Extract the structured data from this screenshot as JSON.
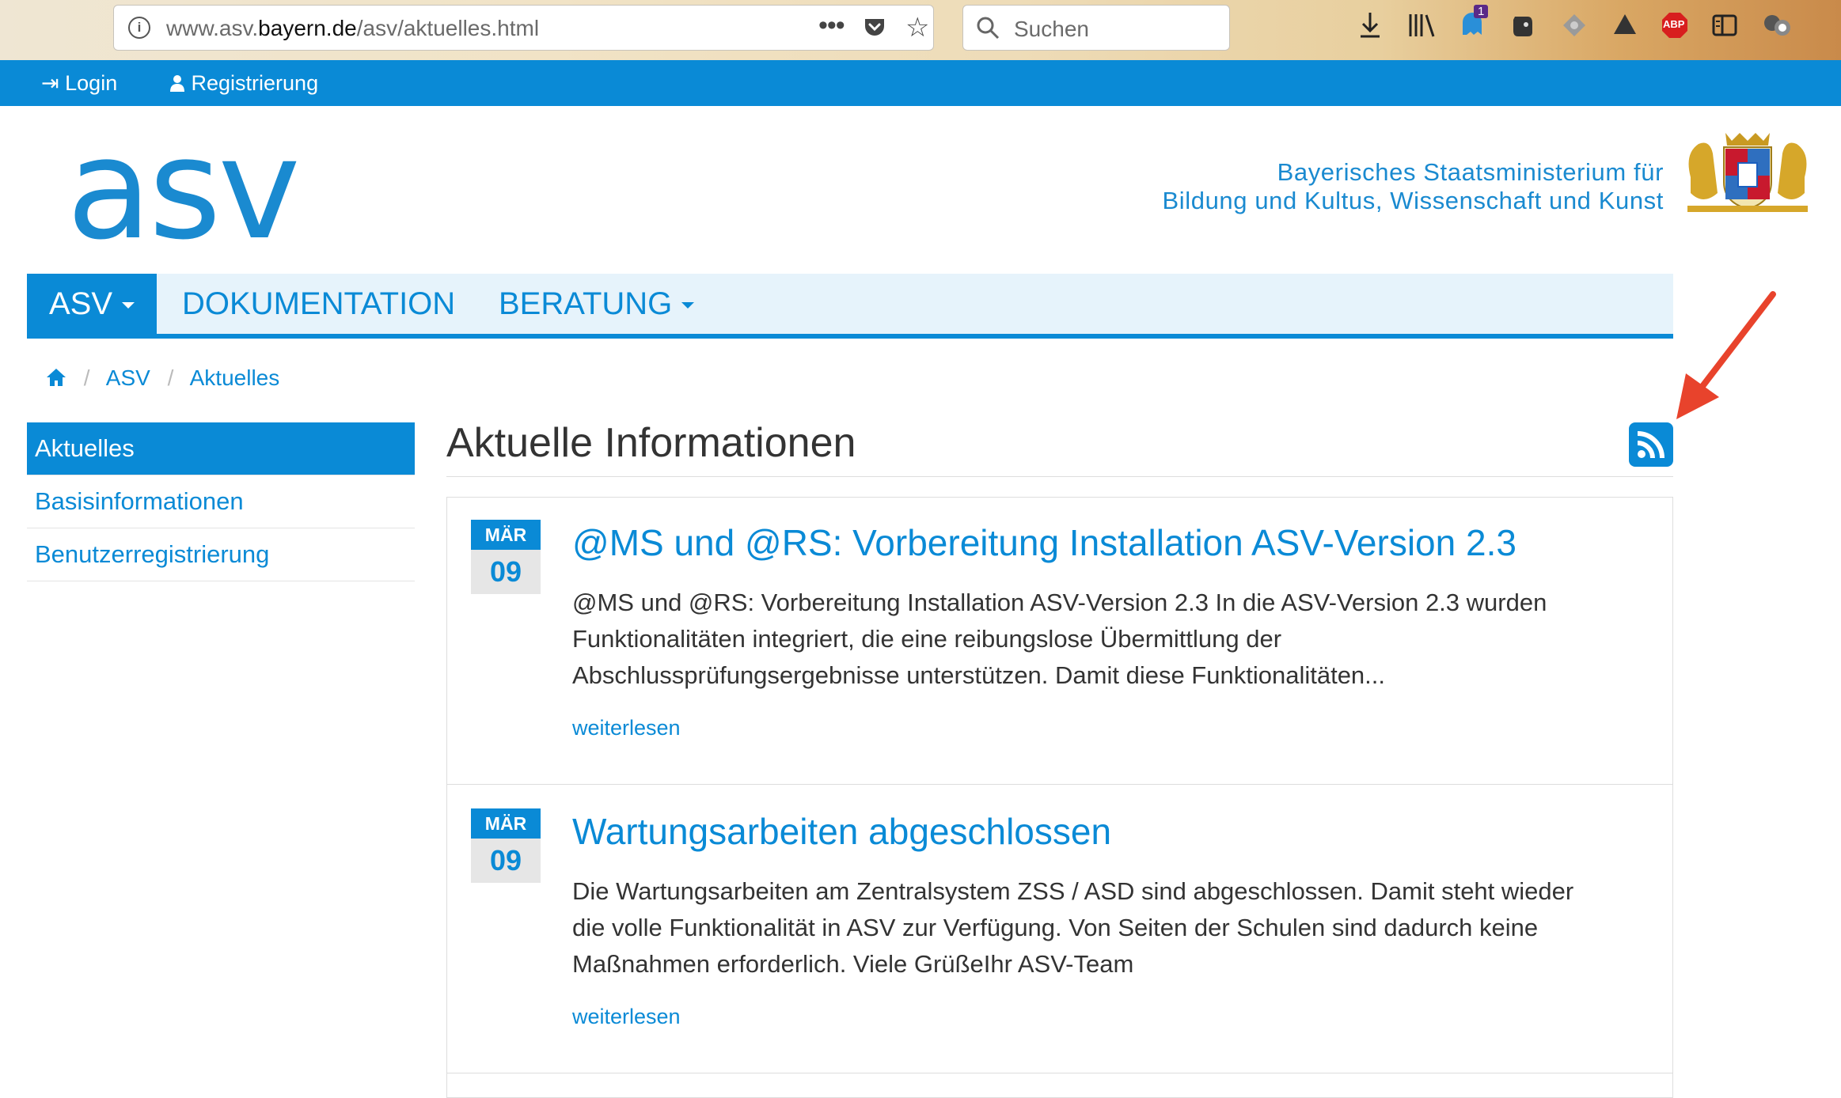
{
  "browser": {
    "url_prefix": "www.asv.",
    "url_domain": "bayern.de",
    "url_path": "/asv/aktuelles.html",
    "search_placeholder": "Suchen",
    "badge_count": "1",
    "abp_label": "ABP"
  },
  "topbar": {
    "login": "Login",
    "register": "Registrierung"
  },
  "header": {
    "logo_text": "asv",
    "ministry_line1": "Bayerisches Staatsministerium für",
    "ministry_line2": "Bildung und Kultus, Wissenschaft und Kunst"
  },
  "nav": {
    "asv": "ASV",
    "documentation": "DOKUMENTATION",
    "consulting": "BERATUNG"
  },
  "breadcrumb": {
    "home": "⌂",
    "asv": "ASV",
    "current": "Aktuelles"
  },
  "sidebar": {
    "items": [
      {
        "label": "Aktuelles"
      },
      {
        "label": "Basisinformationen"
      },
      {
        "label": "Benutzerregistrierung"
      }
    ]
  },
  "main": {
    "title": "Aktuelle Informationen",
    "news": [
      {
        "month": "MÄR",
        "day": "09",
        "title": "@MS und @RS: Vorbereitung Installation ASV-Version 2.3",
        "lines": [
          "@MS und @RS: Vorbereitung Installation ASV-Version 2.3 In die ASV-Version 2.3 wurden",
          "Funktionalitäten integriert, die eine reibungslose Übermittlung der",
          "Abschlussprüfungsergebnisse unterstützen. Damit diese Funktionalitäten..."
        ],
        "more": "weiterlesen"
      },
      {
        "month": "MÄR",
        "day": "09",
        "title": "Wartungsarbeiten abgeschlossen",
        "lines": [
          "Die Wartungsarbeiten am Zentralsystem ZSS / ASD sind abgeschlossen. Damit steht wieder",
          "die volle Funktionalität in ASV zur Verfügung. Von Seiten der Schulen sind dadurch keine",
          "Maßnahmen erforderlich. Viele GrüßeIhr ASV-Team"
        ],
        "more": "weiterlesen"
      }
    ]
  },
  "colors": {
    "brand_blue": "#0a8ad6",
    "nav_bg": "#e6f3fb",
    "arrow_red": "#e8432c"
  }
}
